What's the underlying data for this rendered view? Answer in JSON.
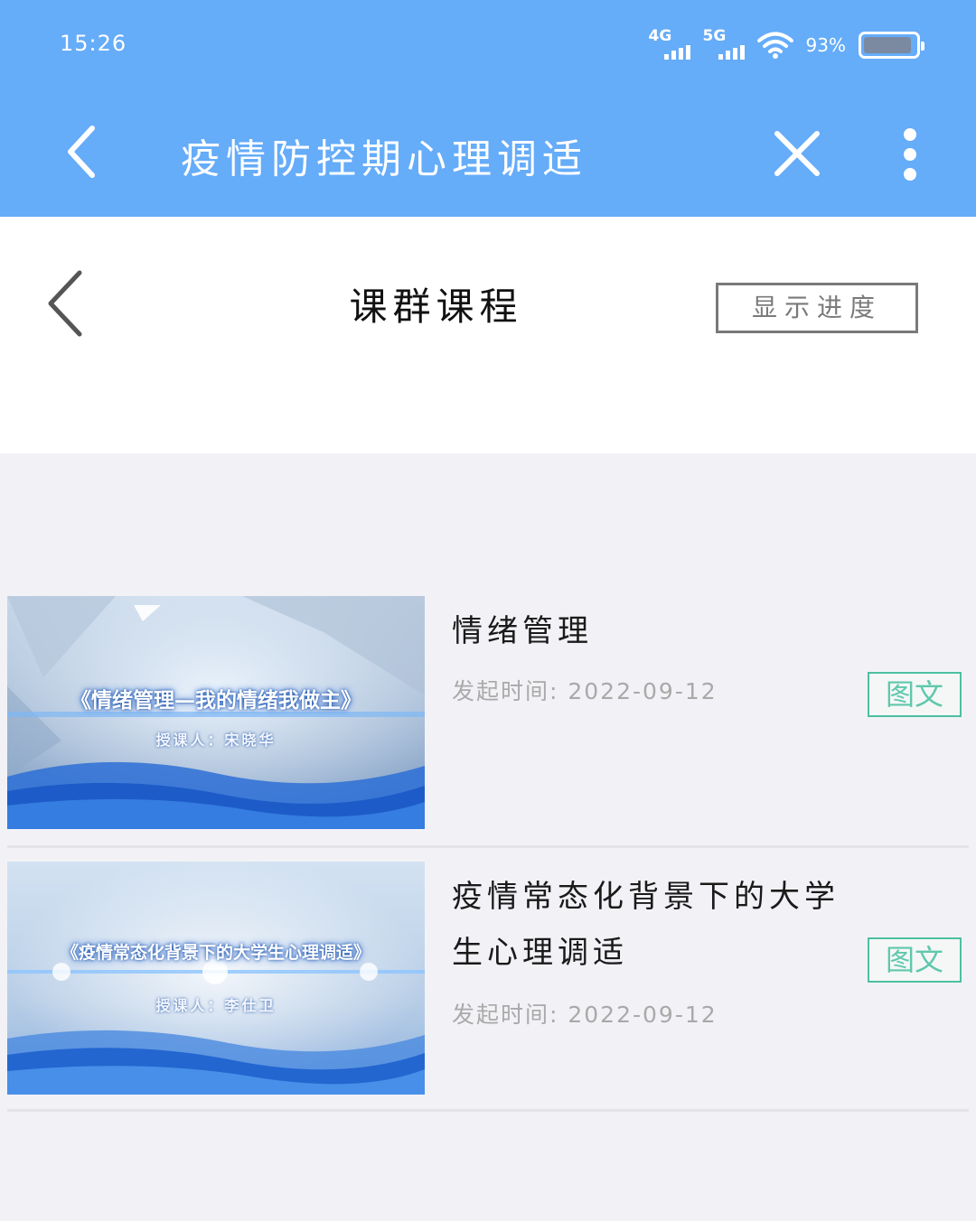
{
  "status_bar": {
    "time": "15:26",
    "network_1": "4G",
    "network_2": "5G",
    "battery_percent": "93%",
    "battery_level": 0.93
  },
  "top_nav": {
    "title": "疫情防控期心理调适",
    "back_icon": "chevron-left-icon",
    "close_icon": "close-icon",
    "more_icon": "more-vertical-icon"
  },
  "page_header": {
    "title": "课群课程",
    "show_progress_label": "显示进度",
    "back_icon": "chevron-left-icon"
  },
  "courses": [
    {
      "title": "情绪管理",
      "date": "发起时间: 2022-09-12",
      "tag": "图文",
      "thumb_title": "《情绪管理—我的情绪我做主》",
      "thumb_lecturer": "授课人：宋晓华"
    },
    {
      "title": "疫情常态化背景下的大学生心理调适",
      "date": "发起时间: 2022-09-12",
      "tag": "图文",
      "thumb_title": "《疫情常态化背景下的大学生心理调适》",
      "thumb_lecturer": "授课人：李仕卫"
    }
  ],
  "colors": {
    "header_blue": "#65acf9",
    "tag_green": "#4cc0a0",
    "background": "#f2f2f6"
  }
}
